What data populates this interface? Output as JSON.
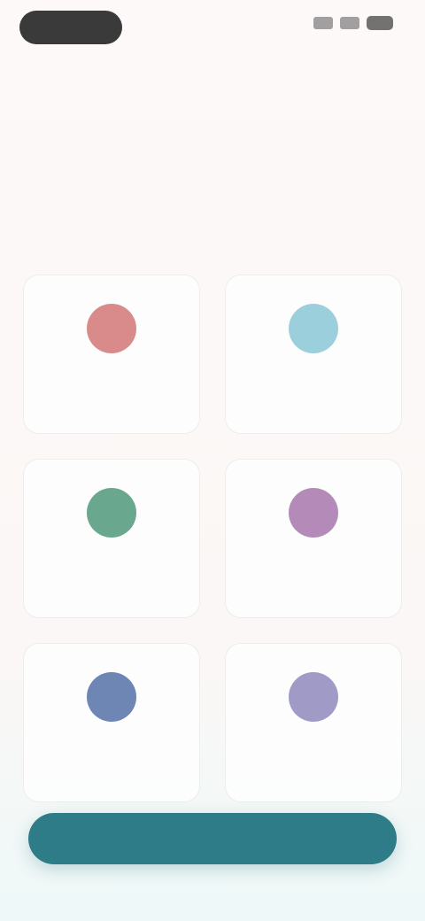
{
  "status_bar": {
    "time": "",
    "icons": [
      "signal-icon",
      "wifi-icon",
      "battery-icon"
    ]
  },
  "header": {
    "title": "",
    "subtitle": ""
  },
  "options": [
    {
      "label": "",
      "icon": "circle-icon",
      "color": "#d98a8a"
    },
    {
      "label": "",
      "icon": "circle-icon",
      "color": "#9ccfdc"
    },
    {
      "label": "",
      "icon": "circle-icon",
      "color": "#6aa78f"
    },
    {
      "label": "",
      "icon": "circle-icon",
      "color": "#b48bb8"
    },
    {
      "label": "",
      "icon": "circle-icon",
      "color": "#6d86b3"
    },
    {
      "label": "",
      "icon": "circle-icon",
      "color": "#a09ac7"
    }
  ],
  "cta": {
    "label": ""
  },
  "colors": {
    "accent": "#2e7c87",
    "background": "#fcf8f7"
  }
}
